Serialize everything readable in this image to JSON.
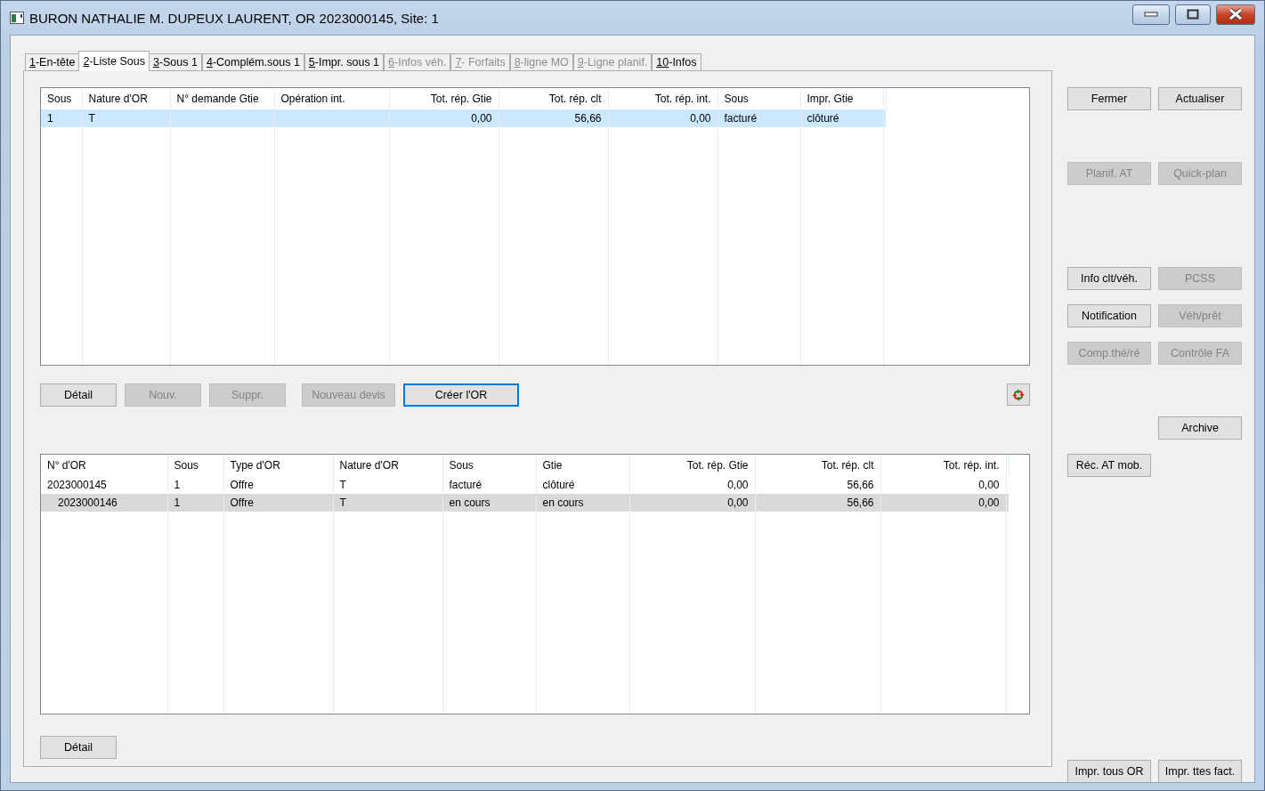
{
  "window": {
    "title": "BURON NATHALIE M. DUPEUX LAURENT, OR 2023000145, Site: 1"
  },
  "tabs": [
    {
      "key": "1",
      "label": "-En-tête",
      "selected": false,
      "disabled": false
    },
    {
      "key": "2",
      "label": "-Liste Sous",
      "selected": true,
      "disabled": false
    },
    {
      "key": "3",
      "label": "-Sous 1",
      "selected": false,
      "disabled": false
    },
    {
      "key": "4",
      "label": "-Complém.sous 1",
      "selected": false,
      "disabled": false
    },
    {
      "key": "5",
      "label": "-Impr. sous 1",
      "selected": false,
      "disabled": false
    },
    {
      "key": "6",
      "label": "-Infos véh.",
      "selected": false,
      "disabled": true
    },
    {
      "key": "7",
      "label": "- Forfaits",
      "selected": false,
      "disabled": true
    },
    {
      "key": "8",
      "label": "-ligne MO",
      "selected": false,
      "disabled": true
    },
    {
      "key": "9",
      "label": "-Ligne planif.",
      "selected": false,
      "disabled": true
    },
    {
      "key": "10",
      "label": "-Infos",
      "selected": false,
      "disabled": false
    }
  ],
  "sous_table": {
    "focused": true,
    "columns": [
      {
        "label": "Sous",
        "kind": "text"
      },
      {
        "label": "Nature d'OR",
        "kind": "text"
      },
      {
        "label": "N° demande Gtie",
        "kind": "text"
      },
      {
        "label": "Opération int.",
        "kind": "text"
      },
      {
        "label": "Tot. rép. Gtie",
        "kind": "number"
      },
      {
        "label": "Tot. rép. clt",
        "kind": "number"
      },
      {
        "label": "Tot. rép. int.",
        "kind": "number"
      },
      {
        "label": "Sous",
        "kind": "text"
      },
      {
        "label": "Impr. Gtie",
        "kind": "text"
      }
    ],
    "rows": [
      {
        "selected": true,
        "cells": [
          "1",
          "T",
          "",
          "",
          "0,00",
          "56,66",
          "0,00",
          "facturé",
          "clôturé"
        ]
      }
    ]
  },
  "sous_buttons": [
    {
      "label": "Détail",
      "disabled": false,
      "focused": false
    },
    {
      "label": "Nouv.",
      "disabled": true,
      "focused": false
    },
    {
      "label": "Suppr.",
      "disabled": true,
      "focused": false
    },
    {
      "label": "Nouveau devis",
      "disabled": true,
      "focused": false
    },
    {
      "label": "Créer l'OR",
      "disabled": false,
      "focused": true
    }
  ],
  "or_table": {
    "focused": false,
    "columns": [
      {
        "label": "N° d'OR",
        "kind": "text"
      },
      {
        "label": "Sous",
        "kind": "text"
      },
      {
        "label": "Type d'OR",
        "kind": "text"
      },
      {
        "label": "Nature d'OR",
        "kind": "text"
      },
      {
        "label": "Sous",
        "kind": "text"
      },
      {
        "label": "Gtie",
        "kind": "text"
      },
      {
        "label": "Tot. rép. Gtie",
        "kind": "number"
      },
      {
        "label": "Tot. rép. clt",
        "kind": "number"
      },
      {
        "label": "Tot. rép. int.",
        "kind": "number"
      }
    ],
    "rows": [
      {
        "selected": false,
        "cells": [
          "2023000145",
          "1",
          "Offre",
          "T",
          "facturé",
          "clôturé",
          "0,00",
          "56,66",
          "0,00"
        ],
        "children": [
          {
            "selected": true,
            "cells": [
              "2023000146",
              "1",
              "Offre",
              "T",
              "en cours",
              "en cours",
              "0,00",
              "56,66",
              "0,00"
            ]
          }
        ]
      }
    ]
  },
  "or_buttons": [
    {
      "label": "Détail",
      "disabled": false,
      "focused": false
    }
  ],
  "side_panel": {
    "rows": [
      {
        "left": {
          "label": "Fermer",
          "disabled": false
        },
        "right": {
          "label": "Actualiser",
          "disabled": false
        }
      },
      {
        "left": {
          "label": "Planif. AT",
          "disabled": true
        },
        "right": {
          "label": "Quick-plan",
          "disabled": true
        }
      },
      {
        "left": {
          "label": "Info clt/véh.",
          "disabled": false
        },
        "right": {
          "label": "PCSS",
          "disabled": true
        }
      },
      {
        "left": {
          "label": "Notification",
          "disabled": false
        },
        "right": {
          "label": "Véh/prêt",
          "disabled": true
        }
      },
      {
        "left": {
          "label": "Comp.thé/ré",
          "disabled": true
        },
        "right": {
          "label": "Contrôle FA",
          "disabled": true
        }
      },
      {
        "right": {
          "label": "Archive",
          "disabled": false
        }
      },
      {
        "left": {
          "label": "Réc. AT mob.",
          "disabled": false
        }
      },
      {
        "left": {
          "label": "Impr. tous OR",
          "disabled": false
        },
        "right": {
          "label": "Impr. ttes fact.",
          "disabled": false
        }
      }
    ]
  }
}
